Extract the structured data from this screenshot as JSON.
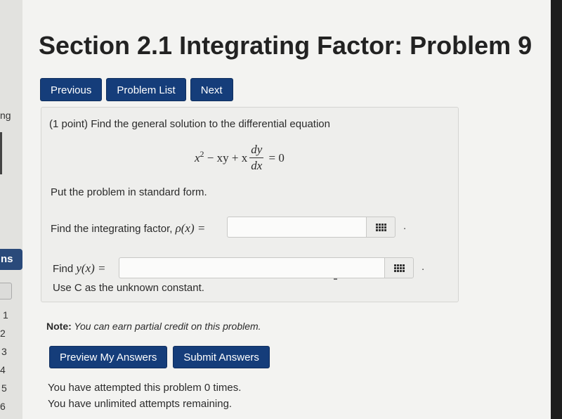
{
  "sidebar": {
    "partial_text": "ng",
    "button_text": "ns",
    "numbers": [
      "1",
      "2",
      "3",
      "4",
      "5",
      "6"
    ]
  },
  "header": {
    "title": "Section 2.1 Integrating Factor: Problem 9"
  },
  "nav": {
    "previous": "Previous",
    "problem_list": "Problem List",
    "next": "Next"
  },
  "problem": {
    "intro": "(1 point) Find the general solution to the differential equation",
    "equation": {
      "x": "x",
      "sup2": "2",
      "minus_xy": " − xy + x",
      "dy": "dy",
      "dx": "dx",
      "equals_zero": " = 0"
    },
    "standard_form": "Put the problem in standard form.",
    "q1_label": "Find the integrating factor,",
    "q1_math": "ρ(x) =",
    "q1_value": "",
    "q2_label": "Find",
    "q2_math": "y(x) =",
    "q2_value": "",
    "constant_note": "Use C as the unknown constant."
  },
  "footer": {
    "note_bold": "Note:",
    "note_text": " You can earn partial credit on this problem.",
    "preview": "Preview My Answers",
    "submit": "Submit Answers",
    "attempts": "You have attempted this problem 0 times.",
    "remaining": "You have unlimited attempts remaining."
  },
  "icons": {
    "matrix": "matrix-grid-icon"
  },
  "colors": {
    "button_bg": "#153d7a",
    "page_bg": "#f3f3f1",
    "box_bg": "#eeeeec"
  }
}
